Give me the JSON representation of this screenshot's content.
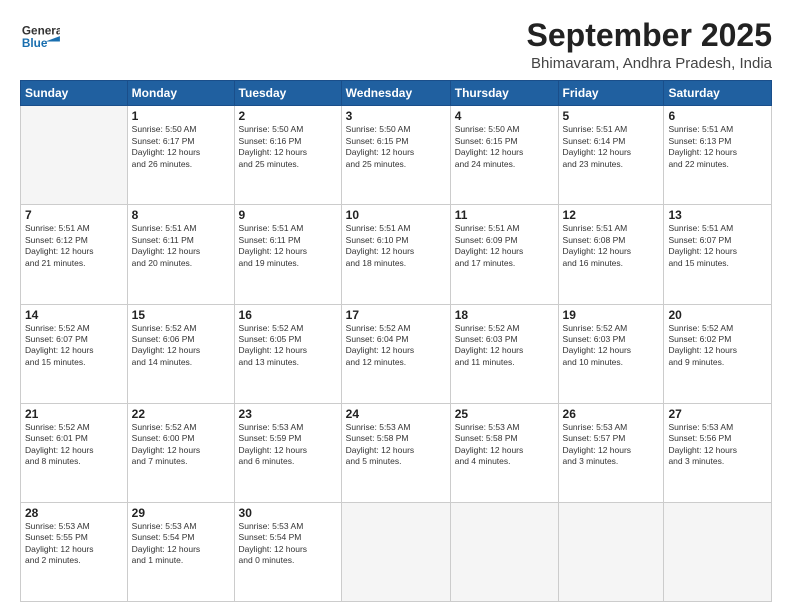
{
  "header": {
    "logo_general": "General",
    "logo_blue": "Blue",
    "main_title": "September 2025",
    "subtitle": "Bhimavaram, Andhra Pradesh, India"
  },
  "calendar": {
    "headers": [
      "Sunday",
      "Monday",
      "Tuesday",
      "Wednesday",
      "Thursday",
      "Friday",
      "Saturday"
    ],
    "rows": [
      [
        {
          "num": "",
          "info": ""
        },
        {
          "num": "1",
          "info": "Sunrise: 5:50 AM\nSunset: 6:17 PM\nDaylight: 12 hours\nand 26 minutes."
        },
        {
          "num": "2",
          "info": "Sunrise: 5:50 AM\nSunset: 6:16 PM\nDaylight: 12 hours\nand 25 minutes."
        },
        {
          "num": "3",
          "info": "Sunrise: 5:50 AM\nSunset: 6:15 PM\nDaylight: 12 hours\nand 25 minutes."
        },
        {
          "num": "4",
          "info": "Sunrise: 5:50 AM\nSunset: 6:15 PM\nDaylight: 12 hours\nand 24 minutes."
        },
        {
          "num": "5",
          "info": "Sunrise: 5:51 AM\nSunset: 6:14 PM\nDaylight: 12 hours\nand 23 minutes."
        },
        {
          "num": "6",
          "info": "Sunrise: 5:51 AM\nSunset: 6:13 PM\nDaylight: 12 hours\nand 22 minutes."
        }
      ],
      [
        {
          "num": "7",
          "info": "Sunrise: 5:51 AM\nSunset: 6:12 PM\nDaylight: 12 hours\nand 21 minutes."
        },
        {
          "num": "8",
          "info": "Sunrise: 5:51 AM\nSunset: 6:11 PM\nDaylight: 12 hours\nand 20 minutes."
        },
        {
          "num": "9",
          "info": "Sunrise: 5:51 AM\nSunset: 6:11 PM\nDaylight: 12 hours\nand 19 minutes."
        },
        {
          "num": "10",
          "info": "Sunrise: 5:51 AM\nSunset: 6:10 PM\nDaylight: 12 hours\nand 18 minutes."
        },
        {
          "num": "11",
          "info": "Sunrise: 5:51 AM\nSunset: 6:09 PM\nDaylight: 12 hours\nand 17 minutes."
        },
        {
          "num": "12",
          "info": "Sunrise: 5:51 AM\nSunset: 6:08 PM\nDaylight: 12 hours\nand 16 minutes."
        },
        {
          "num": "13",
          "info": "Sunrise: 5:51 AM\nSunset: 6:07 PM\nDaylight: 12 hours\nand 15 minutes."
        }
      ],
      [
        {
          "num": "14",
          "info": "Sunrise: 5:52 AM\nSunset: 6:07 PM\nDaylight: 12 hours\nand 15 minutes."
        },
        {
          "num": "15",
          "info": "Sunrise: 5:52 AM\nSunset: 6:06 PM\nDaylight: 12 hours\nand 14 minutes."
        },
        {
          "num": "16",
          "info": "Sunrise: 5:52 AM\nSunset: 6:05 PM\nDaylight: 12 hours\nand 13 minutes."
        },
        {
          "num": "17",
          "info": "Sunrise: 5:52 AM\nSunset: 6:04 PM\nDaylight: 12 hours\nand 12 minutes."
        },
        {
          "num": "18",
          "info": "Sunrise: 5:52 AM\nSunset: 6:03 PM\nDaylight: 12 hours\nand 11 minutes."
        },
        {
          "num": "19",
          "info": "Sunrise: 5:52 AM\nSunset: 6:03 PM\nDaylight: 12 hours\nand 10 minutes."
        },
        {
          "num": "20",
          "info": "Sunrise: 5:52 AM\nSunset: 6:02 PM\nDaylight: 12 hours\nand 9 minutes."
        }
      ],
      [
        {
          "num": "21",
          "info": "Sunrise: 5:52 AM\nSunset: 6:01 PM\nDaylight: 12 hours\nand 8 minutes."
        },
        {
          "num": "22",
          "info": "Sunrise: 5:52 AM\nSunset: 6:00 PM\nDaylight: 12 hours\nand 7 minutes."
        },
        {
          "num": "23",
          "info": "Sunrise: 5:53 AM\nSunset: 5:59 PM\nDaylight: 12 hours\nand 6 minutes."
        },
        {
          "num": "24",
          "info": "Sunrise: 5:53 AM\nSunset: 5:58 PM\nDaylight: 12 hours\nand 5 minutes."
        },
        {
          "num": "25",
          "info": "Sunrise: 5:53 AM\nSunset: 5:58 PM\nDaylight: 12 hours\nand 4 minutes."
        },
        {
          "num": "26",
          "info": "Sunrise: 5:53 AM\nSunset: 5:57 PM\nDaylight: 12 hours\nand 3 minutes."
        },
        {
          "num": "27",
          "info": "Sunrise: 5:53 AM\nSunset: 5:56 PM\nDaylight: 12 hours\nand 3 minutes."
        }
      ],
      [
        {
          "num": "28",
          "info": "Sunrise: 5:53 AM\nSunset: 5:55 PM\nDaylight: 12 hours\nand 2 minutes."
        },
        {
          "num": "29",
          "info": "Sunrise: 5:53 AM\nSunset: 5:54 PM\nDaylight: 12 hours\nand 1 minute."
        },
        {
          "num": "30",
          "info": "Sunrise: 5:53 AM\nSunset: 5:54 PM\nDaylight: 12 hours\nand 0 minutes."
        },
        {
          "num": "",
          "info": ""
        },
        {
          "num": "",
          "info": ""
        },
        {
          "num": "",
          "info": ""
        },
        {
          "num": "",
          "info": ""
        }
      ]
    ]
  }
}
